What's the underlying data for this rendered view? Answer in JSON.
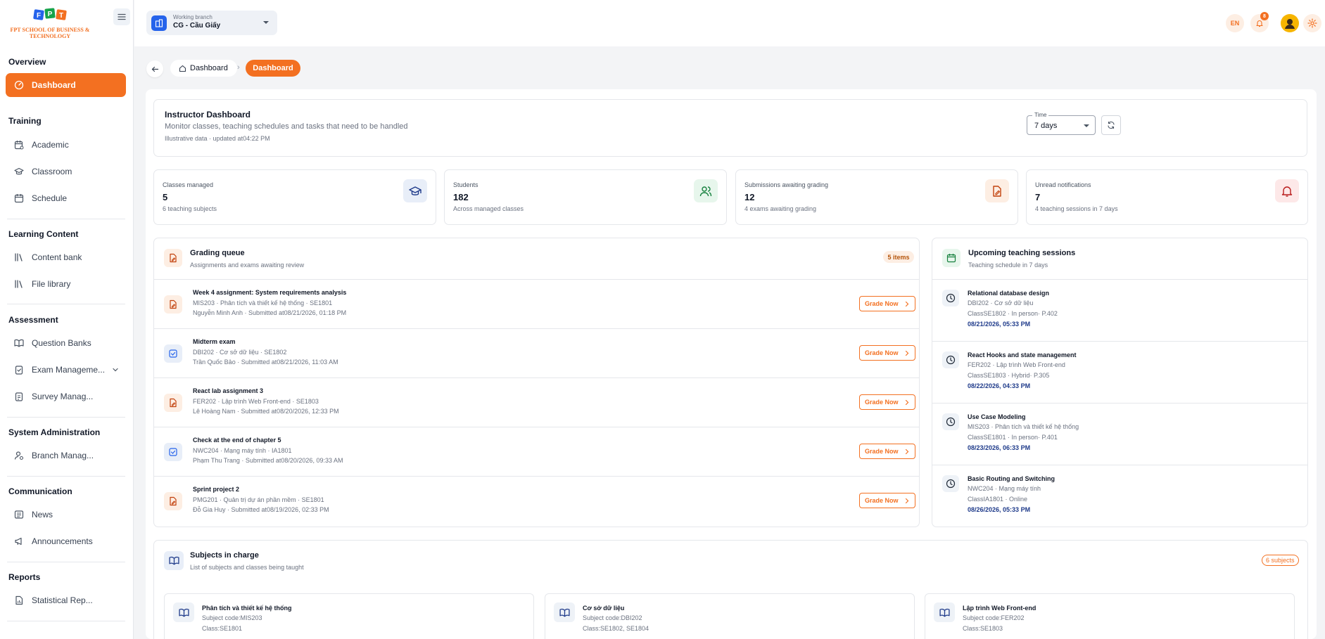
{
  "brand": {
    "logo_text": "FPT SCHOOL OF BUSINESS & TECHNOLOGY",
    "accent": "#f37021"
  },
  "sidebar": {
    "sections": [
      {
        "title": "Overview",
        "items": [
          {
            "label": "Dashboard",
            "icon": "dashboard-gauge-icon",
            "active": true
          }
        ]
      },
      {
        "title": "Training",
        "items": [
          {
            "label": "Academic",
            "icon": "calendar-cog-icon"
          },
          {
            "label": "Classroom",
            "icon": "graduation-cap-icon"
          },
          {
            "label": "Schedule",
            "icon": "calendar-icon"
          }
        ]
      },
      {
        "title": "Learning Content",
        "items": [
          {
            "label": "Content bank",
            "icon": "library-icon"
          },
          {
            "label": "File library",
            "icon": "library-icon"
          }
        ]
      },
      {
        "title": "Assessment",
        "items": [
          {
            "label": "Question Banks",
            "icon": "book-open-icon"
          },
          {
            "label": "Exam Manageme...",
            "icon": "clipboard-check-icon"
          },
          {
            "label": "Survey Manag...",
            "icon": "clipboard-list-icon"
          }
        ]
      },
      {
        "title": "System Administration",
        "items": [
          {
            "label": "Branch Manag...",
            "icon": "user-cog-icon"
          }
        ]
      },
      {
        "title": "Communication",
        "items": [
          {
            "label": "News",
            "icon": "newspaper-icon"
          },
          {
            "label": "Announcements",
            "icon": "megaphone-icon"
          }
        ]
      },
      {
        "title": "Reports",
        "items": [
          {
            "label": "Statistical Rep...",
            "icon": "file-chart-icon"
          }
        ]
      }
    ]
  },
  "topbar": {
    "branch_caption": "Working branch",
    "branch_value": "CG - Cầu Giấy",
    "language": "EN",
    "notification_count": "8"
  },
  "breadcrumb": {
    "home": "Dashboard",
    "current": "Dashboard"
  },
  "header": {
    "title": "Instructor Dashboard",
    "subtitle": "Monitor classes, teaching schedules and tasks that need to be handled",
    "note": "Illustrative data · updated at04:22 PM",
    "time_label": "Time",
    "time_value": "7 days"
  },
  "stats": [
    {
      "label": "Classes managed",
      "value": "5",
      "note": "6 teaching subjects",
      "icon": "graduation-cap-icon",
      "icon_color": "#1e3a8a",
      "bg": "#e8eef8"
    },
    {
      "label": "Students",
      "value": "182",
      "note": "Across managed classes",
      "icon": "users-icon",
      "icon_color": "#15803d",
      "bg": "#e7f6ec"
    },
    {
      "label": "Submissions awaiting grading",
      "value": "12",
      "note": "4 exams awaiting grading",
      "icon": "file-pen-icon",
      "icon_color": "#c2410c",
      "bg": "#fdeee3"
    },
    {
      "label": "Unread notifications",
      "value": "7",
      "note": "4 teaching sessions in 7 days",
      "icon": "bell-icon",
      "icon_color": "#b91c1c",
      "bg": "#fde8e8"
    }
  ],
  "grading": {
    "title": "Grading queue",
    "subtitle": "Assignments and exams awaiting review",
    "count": "5 items",
    "button_label": "Grade Now",
    "items": [
      {
        "title": "Week 4 assignment: System requirements analysis",
        "course": "MIS203 · Phân tích và thiết kế hệ thống · SE1801",
        "meta": "Nguyễn Minh Anh · Submitted at08/21/2026, 01:18 PM",
        "kind": "file"
      },
      {
        "title": "Midterm exam",
        "course": "DBI202 · Cơ sở dữ liệu · SE1802",
        "meta": "Trần Quốc Bảo · Submitted at08/21/2026, 11:03 AM",
        "kind": "check"
      },
      {
        "title": "React lab assignment 3",
        "course": "FER202 · Lập trình Web Front-end · SE1803",
        "meta": "Lê Hoàng Nam · Submitted at08/20/2026, 12:33 PM",
        "kind": "file"
      },
      {
        "title": "Check at the end of chapter 5",
        "course": "NWC204 · Mạng máy tính · IA1801",
        "meta": "Phạm Thu Trang · Submitted at08/20/2026, 09:33 AM",
        "kind": "check"
      },
      {
        "title": "Sprint project 2",
        "course": "PMG201 · Quản trị dự án phần mềm · SE1801",
        "meta": "Đỗ Gia Huy · Submitted at08/19/2026, 02:33 PM",
        "kind": "file"
      }
    ]
  },
  "sessions": {
    "title": "Upcoming teaching sessions",
    "subtitle": "Teaching schedule in 7 days",
    "items": [
      {
        "title": "Relational database design",
        "course": "DBI202 · Cơ sở dữ liệu",
        "place": "ClassSE1802 · In person· P.402",
        "time": "08/21/2026, 05:33 PM"
      },
      {
        "title": "React Hooks and state management",
        "course": "FER202 · Lập trình Web Front-end",
        "place": "ClassSE1803 · Hybrid· P.305",
        "time": "08/22/2026, 04:33 PM"
      },
      {
        "title": "Use Case Modeling",
        "course": "MIS203 · Phân tích và thiết kế hệ thống",
        "place": "ClassSE1801 · In person· P.401",
        "time": "08/23/2026, 06:33 PM"
      },
      {
        "title": "Basic Routing and Switching",
        "course": "NWC204 · Mạng máy tính",
        "place": "ClassIA1801 · Online",
        "time": "08/26/2026, 05:33 PM"
      }
    ]
  },
  "subjects": {
    "title": "Subjects in charge",
    "subtitle": "List of subjects and classes being taught",
    "count": "6 subjects",
    "items": [
      {
        "name": "Phân tích và thiết kế hệ thống",
        "code": "Subject code:MIS203",
        "classes": "Class:SE1801"
      },
      {
        "name": "Cơ sở dữ liệu",
        "code": "Subject code:DBI202",
        "classes": "Class:SE1802, SE1804"
      },
      {
        "name": "Lập trình Web Front-end",
        "code": "Subject code:FER202",
        "classes": "Class:SE1803"
      }
    ]
  }
}
